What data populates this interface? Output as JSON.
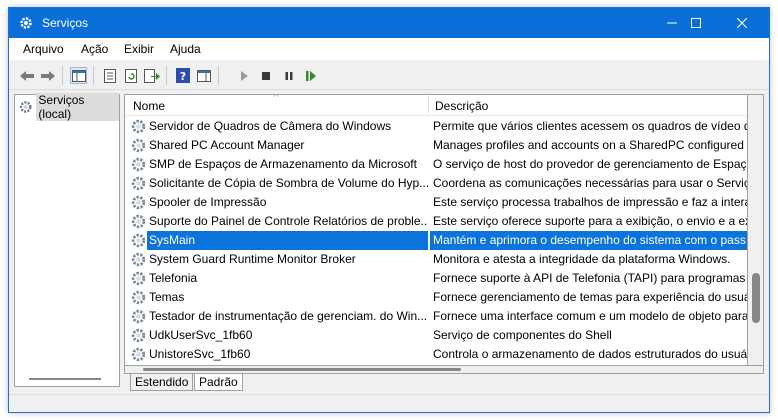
{
  "window": {
    "title": "Serviços"
  },
  "menu": [
    "Arquivo",
    "Ação",
    "Exibir",
    "Ajuda"
  ],
  "tree": {
    "root_label": "Serviços (local)"
  },
  "table": {
    "columns": [
      "Nome",
      "Descrição"
    ],
    "rows": [
      {
        "name": "Servidor de Quadros de Câmera do Windows",
        "description": "Permite que vários clientes acessem os quadros de vídeo de"
      },
      {
        "name": "Shared PC Account Manager",
        "description": "Manages profiles and accounts on a SharedPC configured o"
      },
      {
        "name": "SMP de Espaços de Armazenamento da Microsoft",
        "description": "O serviço de host do provedor de gerenciamento de Espaço"
      },
      {
        "name": "Solicitante de Cópia de Sombra de Volume do Hyp...",
        "description": "Coordena as comunicações necessárias para usar o Serviço"
      },
      {
        "name": "Spooler de Impressão",
        "description": "Este serviço processa trabalhos de impressão e faz a interaç"
      },
      {
        "name": "Suporte do Painel de Controle Relatórios de proble...",
        "description": "Este serviço oferece suporte para a exibição, o envio e a exc"
      },
      {
        "name": "SysMain",
        "description": "Mantém e aprimora o desempenho do sistema com o pass",
        "selected": true
      },
      {
        "name": "System Guard Runtime Monitor Broker",
        "description": "Monitora e atesta a integridade da plataforma Windows."
      },
      {
        "name": "Telefonia",
        "description": "Fornece suporte à API de Telefonia (TAPI) para programas q"
      },
      {
        "name": "Temas",
        "description": "Fornece gerenciamento de temas para experiência do usuá"
      },
      {
        "name": "Testador de instrumentação de gerenciam. do Win...",
        "description": "Fornece uma interface comum e um modelo de objeto para"
      },
      {
        "name": "UdkUserSvc_1fb60",
        "description": "Serviço de componentes do Shell"
      },
      {
        "name": "UnistoreSvc_1fb60",
        "description": "Controla o armazenamento de dados estruturados do usuá"
      }
    ]
  },
  "tabs": [
    "Estendido",
    "Padrão"
  ],
  "colors": {
    "titlebar": "#0a6fd8",
    "selection": "#0a74da"
  }
}
